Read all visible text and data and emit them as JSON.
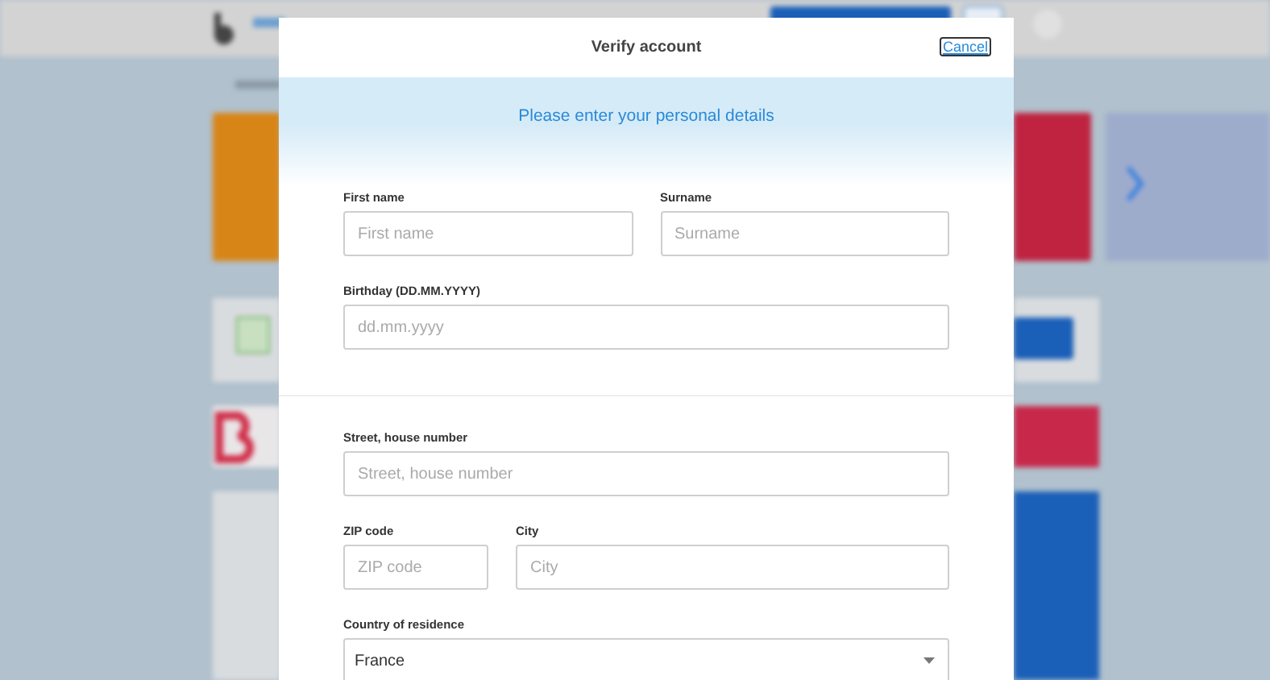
{
  "dialog": {
    "title": "Verify account",
    "cancel": "Cancel",
    "intro": "Please enter your personal details",
    "sections": [
      {
        "rows": [
          [
            {
              "kind": "text",
              "label": "First name",
              "placeholder": "First name"
            },
            {
              "kind": "text",
              "label": "Surname",
              "placeholder": "Surname"
            }
          ],
          [
            {
              "kind": "text",
              "label": "Birthday (DD.MM.YYYY)",
              "placeholder": "dd.mm.yyyy"
            }
          ]
        ]
      },
      {
        "rows": [
          [
            {
              "kind": "text",
              "label": "Street, house number",
              "placeholder": "Street, house number"
            }
          ],
          [
            {
              "kind": "short-text",
              "label": "ZIP code",
              "placeholder": "ZIP code"
            },
            {
              "kind": "text",
              "label": "City",
              "placeholder": "City"
            }
          ],
          [
            {
              "kind": "select",
              "label": "Country of residence",
              "value": "France"
            }
          ]
        ]
      }
    ]
  }
}
